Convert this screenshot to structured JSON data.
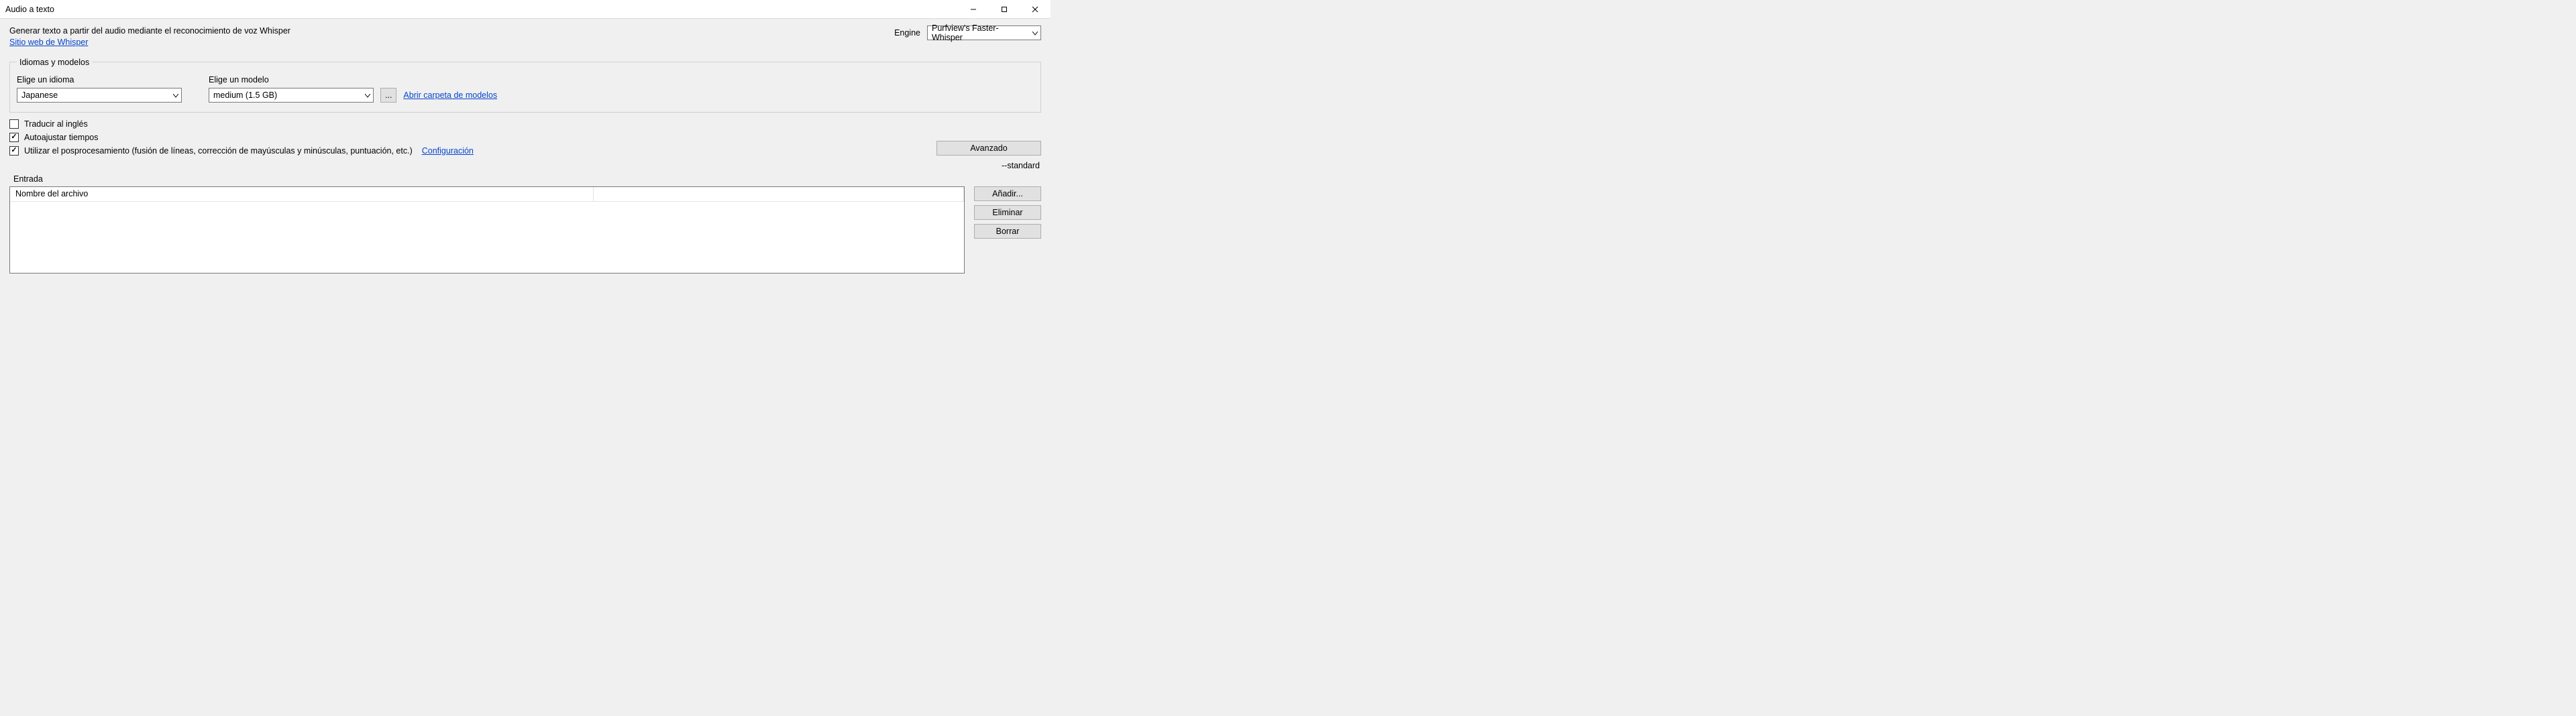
{
  "titlebar": {
    "title": "Audio a texto"
  },
  "header": {
    "description": "Generar texto a partir del audio mediante el reconocimiento de voz Whisper",
    "whisper_link": "Sitio web de Whisper",
    "engine_label": "Engine",
    "engine_value": "Purfview's Faster-Whisper"
  },
  "group": {
    "legend": "Idiomas y modelos",
    "language_label": "Elige un idioma",
    "language_value": "Japanese",
    "model_label": "Elige un modelo",
    "model_value": "medium (1.5 GB)",
    "ellipsis": "...",
    "open_models_link": "Abrir carpeta de modelos"
  },
  "checks": {
    "translate": {
      "label": "Traducir al inglés",
      "checked": false
    },
    "autoadjust": {
      "label": "Autoajustar tiempos",
      "checked": true
    },
    "postproc": {
      "label": "Utilizar el posprocesamiento (fusión de líneas, corrección de mayúsculas y minúsculas, puntuación, etc.)",
      "checked": true,
      "config_link": "Configuración"
    }
  },
  "advanced": {
    "button": "Avanzado",
    "standard": "--standard"
  },
  "entrada": {
    "label": "Entrada",
    "col_filename": "Nombre del archivo"
  },
  "sidebtns": {
    "add": "Añadir...",
    "remove": "Eliminar",
    "clear": "Borrar"
  }
}
